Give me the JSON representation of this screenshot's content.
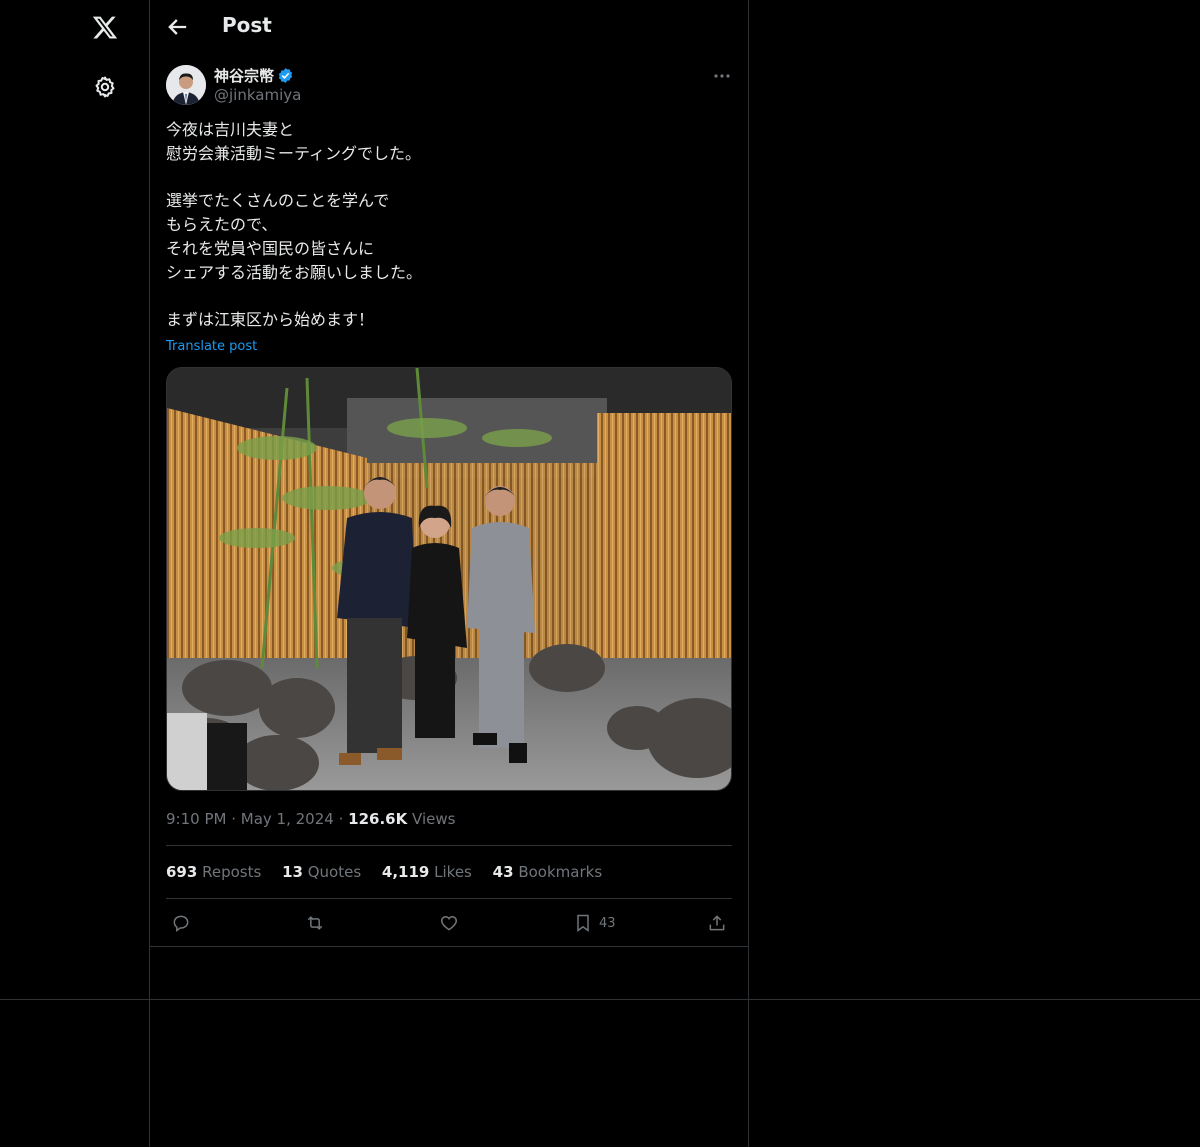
{
  "header": {
    "title": "Post"
  },
  "author": {
    "name": "神谷宗幣",
    "handle": "@jinkamiya"
  },
  "post": {
    "paragraphs": [
      [
        "今夜は吉川夫妻と",
        "慰労会兼活動ミーティングでした。"
      ],
      [
        "選挙でたくさんのことを学んで",
        "もらえたので、",
        "それを党員や国民の皆さんに",
        "シェアする活動をお願いしました。"
      ],
      [
        "まずは江東区から始めます！"
      ]
    ],
    "translate": "Translate post",
    "time": "9:10 PM",
    "date": "May 1, 2024",
    "views_count": "126.6K",
    "views_label": "Views"
  },
  "stats": {
    "reposts_count": "693",
    "reposts_label": "Reposts",
    "quotes_count": "13",
    "quotes_label": "Quotes",
    "likes_count": "4,119",
    "likes_label": "Likes",
    "bookmarks_count": "43",
    "bookmarks_label": "Bookmarks"
  },
  "actions": {
    "bookmark_count": "43"
  },
  "icons": {
    "logo": "x-logo-icon",
    "settings": "gear-icon",
    "back": "arrow-left-icon",
    "verified": "verified-badge-icon",
    "more": "more-dots-icon",
    "reply": "reply-icon",
    "repost": "repost-icon",
    "like": "heart-icon",
    "bookmark": "bookmark-icon",
    "share": "share-icon"
  },
  "colors": {
    "background": "#000000",
    "text": "#e7e9ea",
    "muted": "#71767b",
    "accent": "#1d9bf0",
    "border": "#2f3336"
  }
}
